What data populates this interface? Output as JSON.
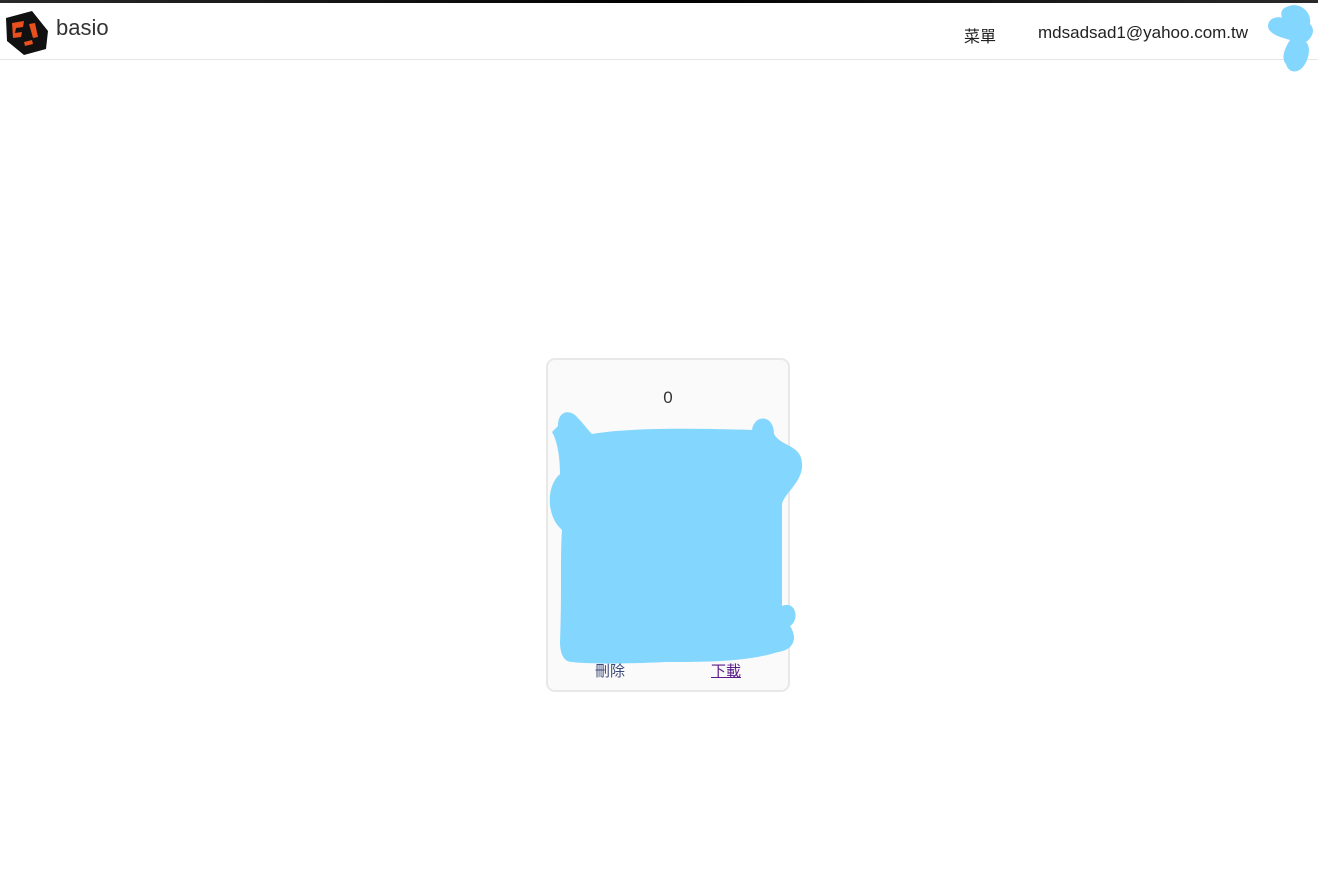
{
  "navbar": {
    "brand_name": "basio",
    "menu_label": "菜單",
    "user_email": "mdsadsad1@yahoo.com.tw"
  },
  "card": {
    "count": "0",
    "delete_label": "刪除",
    "download_label": "下載"
  },
  "colors": {
    "scribble": "#83d6fd",
    "logo_dark": "#111111",
    "logo_accent": "#e8501e"
  },
  "icons": {
    "brand": "brand-logo-icon",
    "avatar": "user-avatar-icon"
  }
}
